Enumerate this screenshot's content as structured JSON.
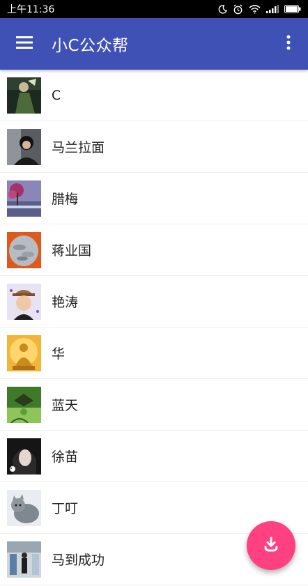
{
  "status_bar": {
    "time": "上午11:36",
    "icons": [
      "moon-icon",
      "alarm-icon",
      "wifi-icon",
      "signal-icon",
      "battery-icon"
    ]
  },
  "app_bar": {
    "title": "小C公众帮",
    "menu_icon": "menu-icon",
    "overflow_icon": "more-vert-icon",
    "color": "#3f51b5"
  },
  "contacts": [
    {
      "name": "C"
    },
    {
      "name": "马兰拉面"
    },
    {
      "name": "腊梅"
    },
    {
      "name": "蒋业国"
    },
    {
      "name": "艳涛"
    },
    {
      "name": "华"
    },
    {
      "name": "蓝天"
    },
    {
      "name": "徐苗"
    },
    {
      "name": "丁叮"
    },
    {
      "name": "马到成功"
    }
  ],
  "fab": {
    "icon": "download-icon",
    "color": "#ff4081"
  }
}
